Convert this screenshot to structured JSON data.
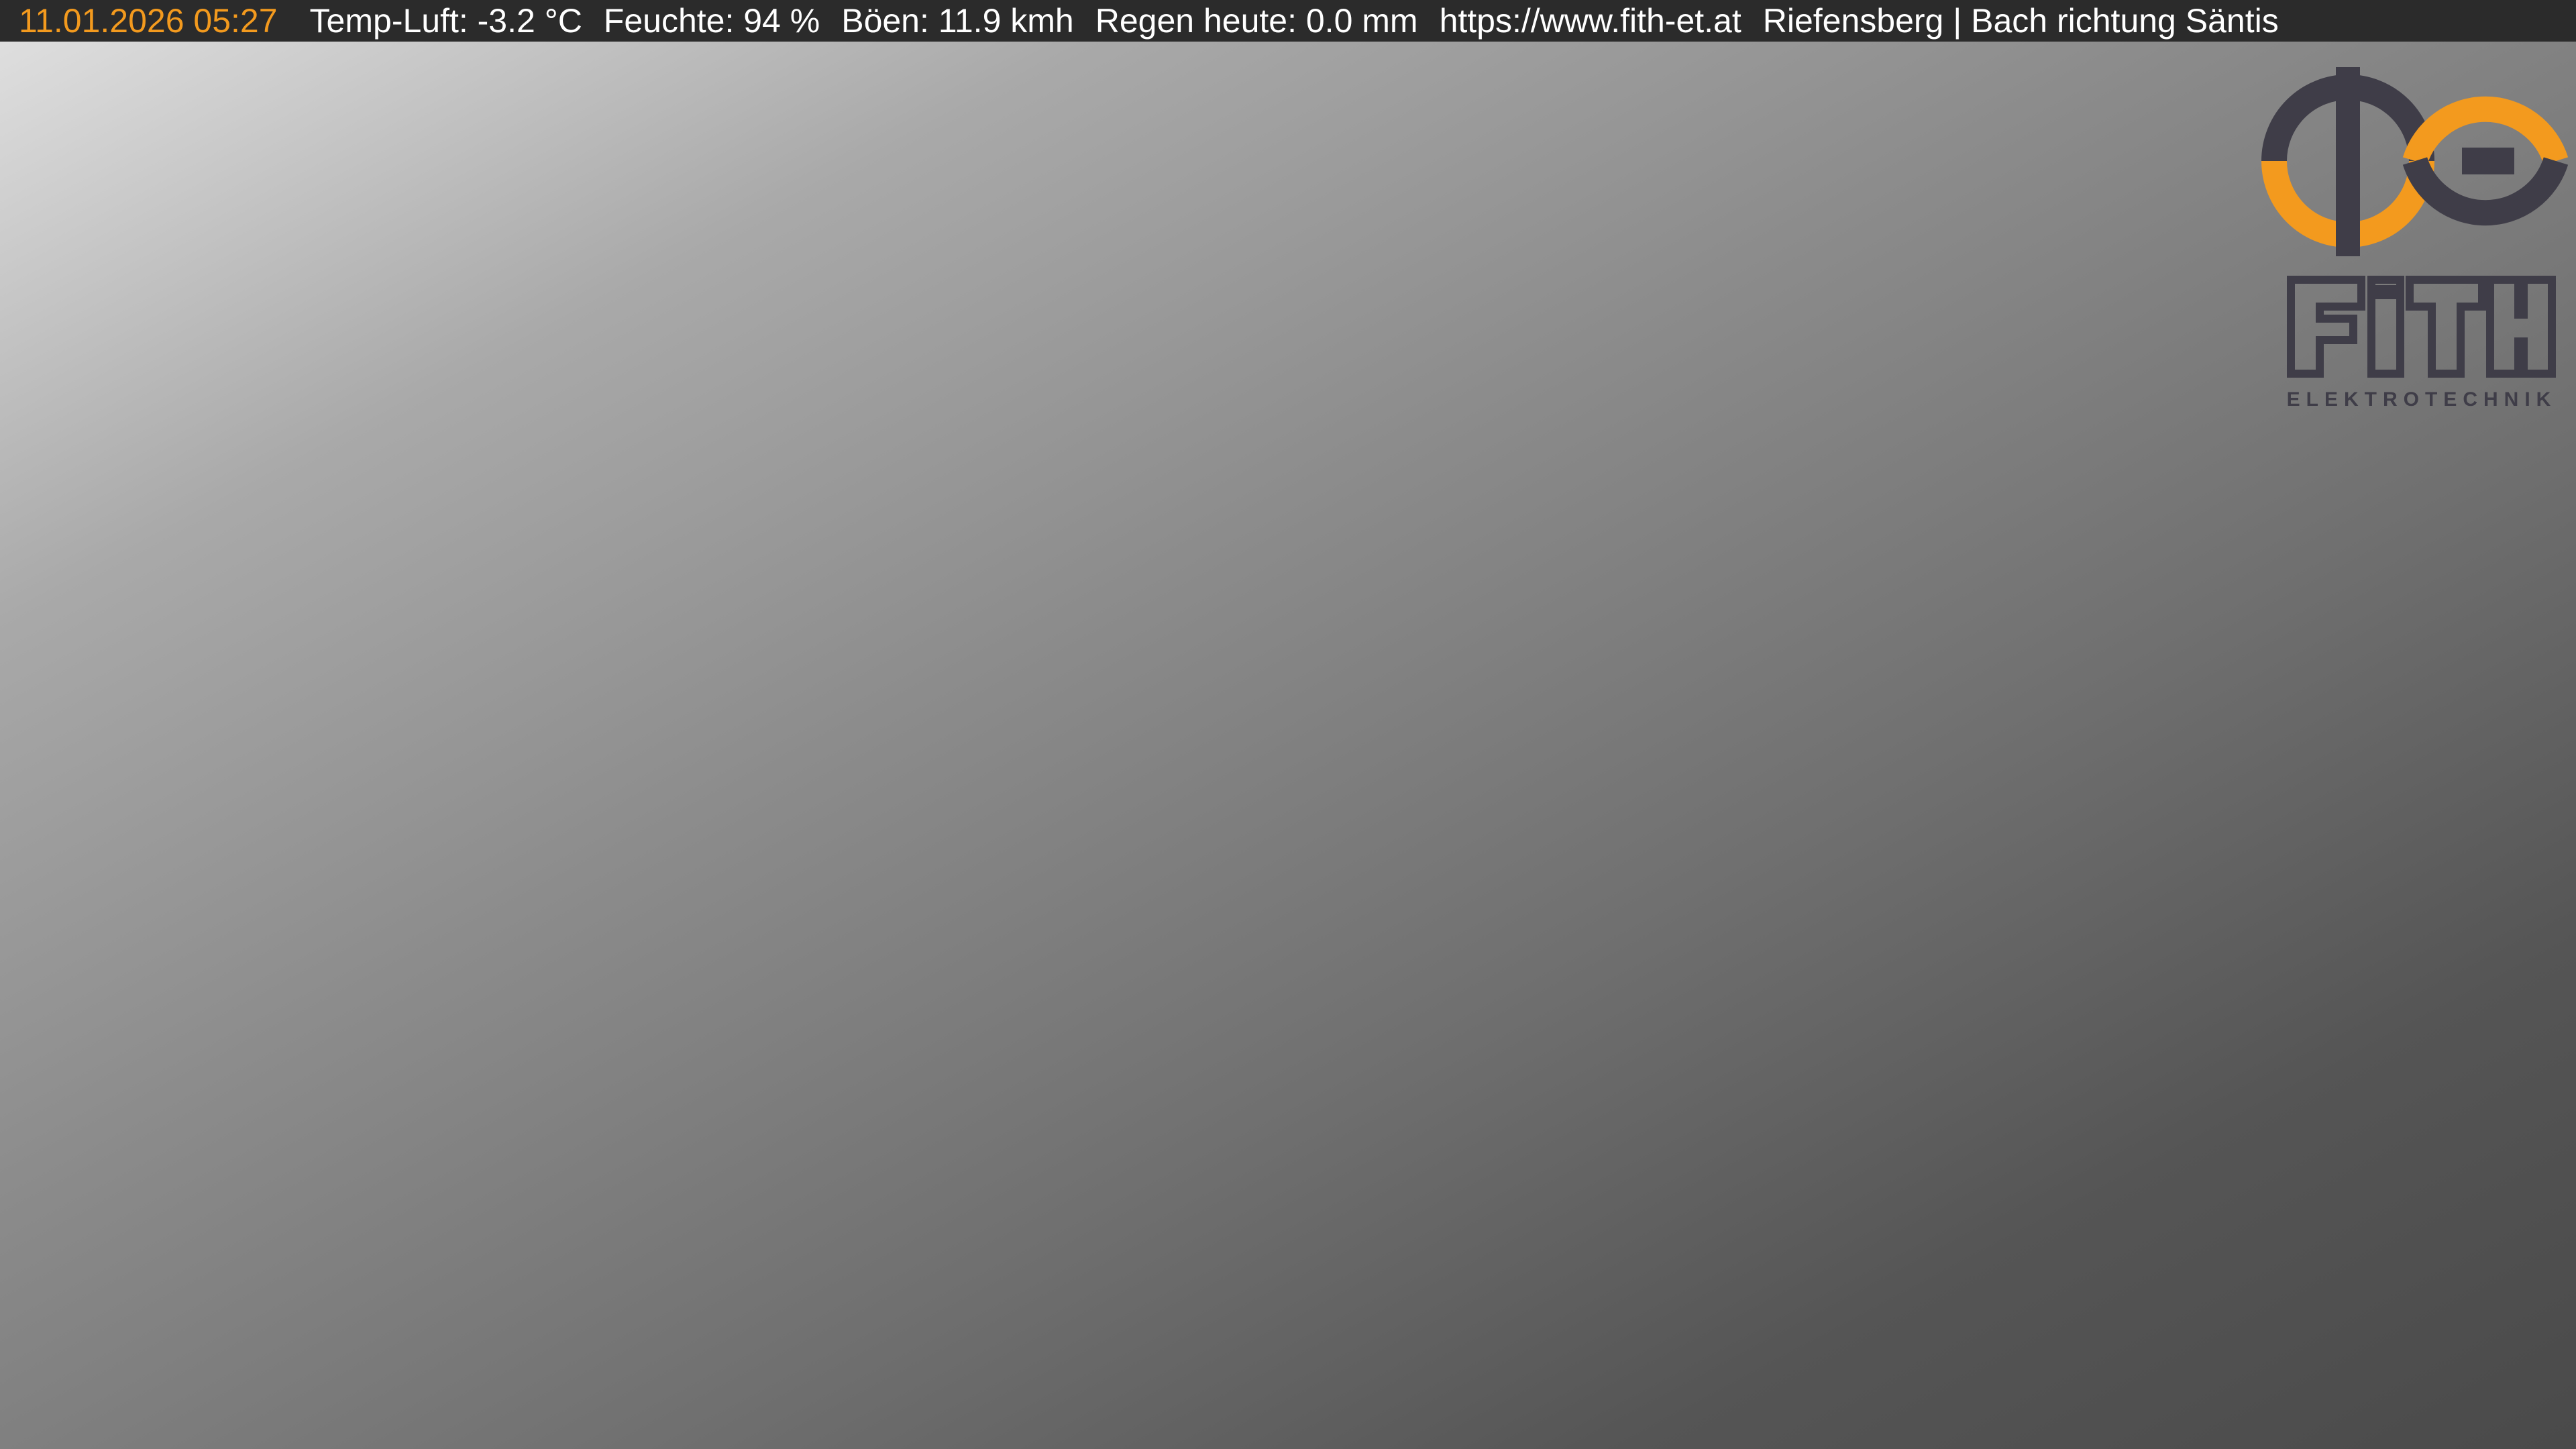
{
  "overlay": {
    "timestamp": "11.01.2026 05:27",
    "temperature": "Temp-Luft: -3.2 °C",
    "humidity": "Feuchte: 94 %",
    "gusts": "Böen: 11.9 kmh",
    "rain": "Regen heute: 0.0 mm",
    "url": "https://www.fith-et.at",
    "location": "Riefensberg | Bach richtung Säntis"
  },
  "logo": {
    "name": "FITH",
    "subtitle": "ELEKTROTECHNIK",
    "colors": {
      "orange": "#f39a1e",
      "dark": "#3f3d48"
    }
  },
  "colors": {
    "timestamp": "#f39a1e",
    "overlay_text": "#ffffff",
    "overlay_background": "#2b2b2b"
  }
}
